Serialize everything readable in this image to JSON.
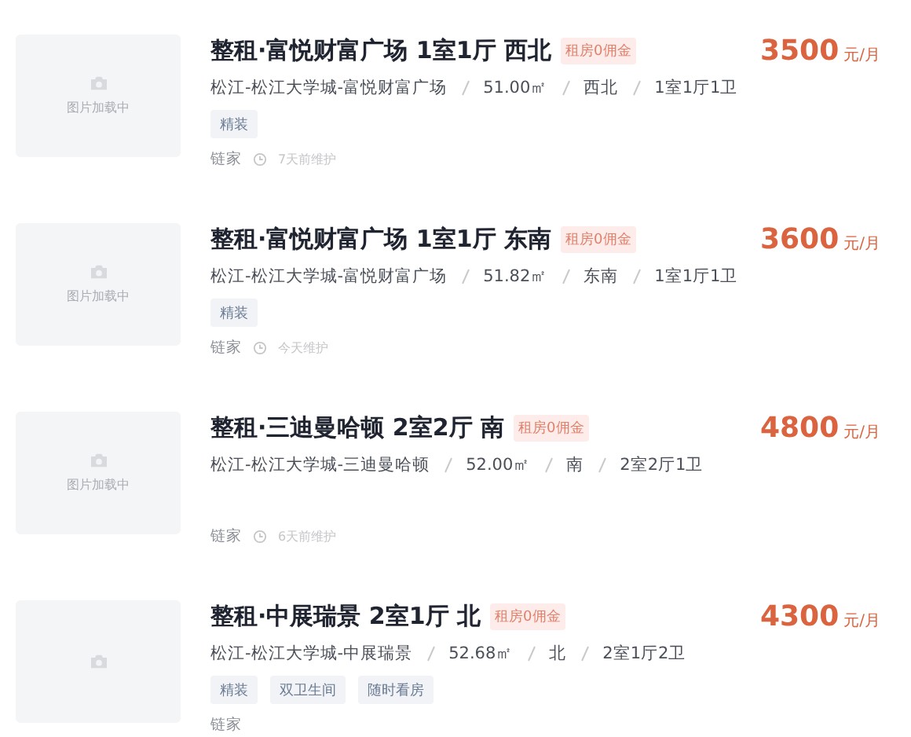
{
  "listings": [
    {
      "image": {
        "caption": "图片加载中"
      },
      "title": "整租·富悦财富广场 1室1厅 西北",
      "badge": "租房0佣金",
      "price": "3500",
      "unit": "元/月",
      "meta": [
        "松江-松江大学城-富悦财富广场",
        "51.00㎡",
        "西北",
        "1室1厅1卫"
      ],
      "tags": [
        "精装"
      ],
      "agency": "链家",
      "updated": "7天前维护"
    },
    {
      "image": {
        "caption": "图片加载中"
      },
      "title": "整租·富悦财富广场 1室1厅 东南",
      "badge": "租房0佣金",
      "price": "3600",
      "unit": "元/月",
      "meta": [
        "松江-松江大学城-富悦财富广场",
        "51.82㎡",
        "东南",
        "1室1厅1卫"
      ],
      "tags": [
        "精装"
      ],
      "agency": "链家",
      "updated": "今天维护"
    },
    {
      "image": {
        "caption": "图片加载中"
      },
      "title": "整租·三迪曼哈顿 2室2厅 南",
      "badge": "租房0佣金",
      "price": "4800",
      "unit": "元/月",
      "meta": [
        "松江-松江大学城-三迪曼哈顿",
        "52.00㎡",
        "南",
        "2室2厅1卫"
      ],
      "agency": "链家",
      "updated": "6天前维护"
    },
    {
      "title": "整租·中展瑞景 2室1厅 北",
      "badge": "租房0佣金",
      "price": "4300",
      "unit": "元/月",
      "meta": [
        "松江-松江大学城-中展瑞景",
        "52.68㎡",
        "北",
        "2室1厅2卫"
      ],
      "tags": [
        "精装",
        "双卫生间",
        "随时看房"
      ],
      "agency": "链家"
    }
  ]
}
